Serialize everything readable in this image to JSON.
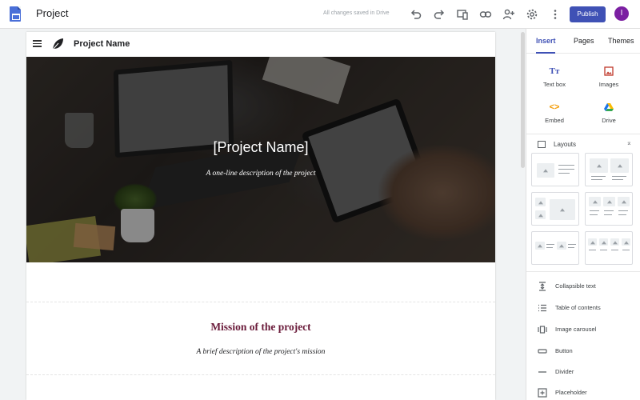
{
  "app": {
    "title": "Project",
    "save_status": "All changes saved in Drive",
    "publish_label": "Publish",
    "avatar_initial": "I",
    "colors": {
      "accent": "#3f51b5",
      "avatar": "#7b1fa2",
      "docs_blue": "#4a6fd8"
    },
    "toolbar_icons": [
      "undo-icon",
      "redo-icon",
      "preview-icon",
      "link-icon",
      "add-person-icon",
      "gear-icon",
      "more-vert-icon"
    ]
  },
  "site": {
    "name": "Project Name",
    "hero": {
      "title": "[Project Name]",
      "subtitle": "A one-line description of the project"
    },
    "mission": {
      "title": "Mission of the project",
      "description": "A brief description of the project's mission"
    },
    "colors": {
      "mission_title": "#6a1b3a"
    }
  },
  "panel": {
    "tabs": [
      {
        "label": "Insert",
        "active": true
      },
      {
        "label": "Pages",
        "active": false
      },
      {
        "label": "Themes",
        "active": false
      }
    ],
    "insert_items": [
      {
        "label": "Text box",
        "icon": "text-box-icon"
      },
      {
        "label": "Images",
        "icon": "image-icon"
      },
      {
        "label": "Embed",
        "icon": "embed-icon"
      },
      {
        "label": "Drive",
        "icon": "drive-icon"
      }
    ],
    "layouts_label": "Layouts",
    "layout_tile_count": 6,
    "components": [
      {
        "label": "Collapsible text",
        "icon": "collapsible-text-icon"
      },
      {
        "label": "Table of contents",
        "icon": "table-of-contents-icon"
      },
      {
        "label": "Image carousel",
        "icon": "image-carousel-icon"
      },
      {
        "label": "Button",
        "icon": "button-icon"
      },
      {
        "label": "Divider",
        "icon": "divider-icon"
      },
      {
        "label": "Placeholder",
        "icon": "placeholder-icon"
      }
    ]
  }
}
